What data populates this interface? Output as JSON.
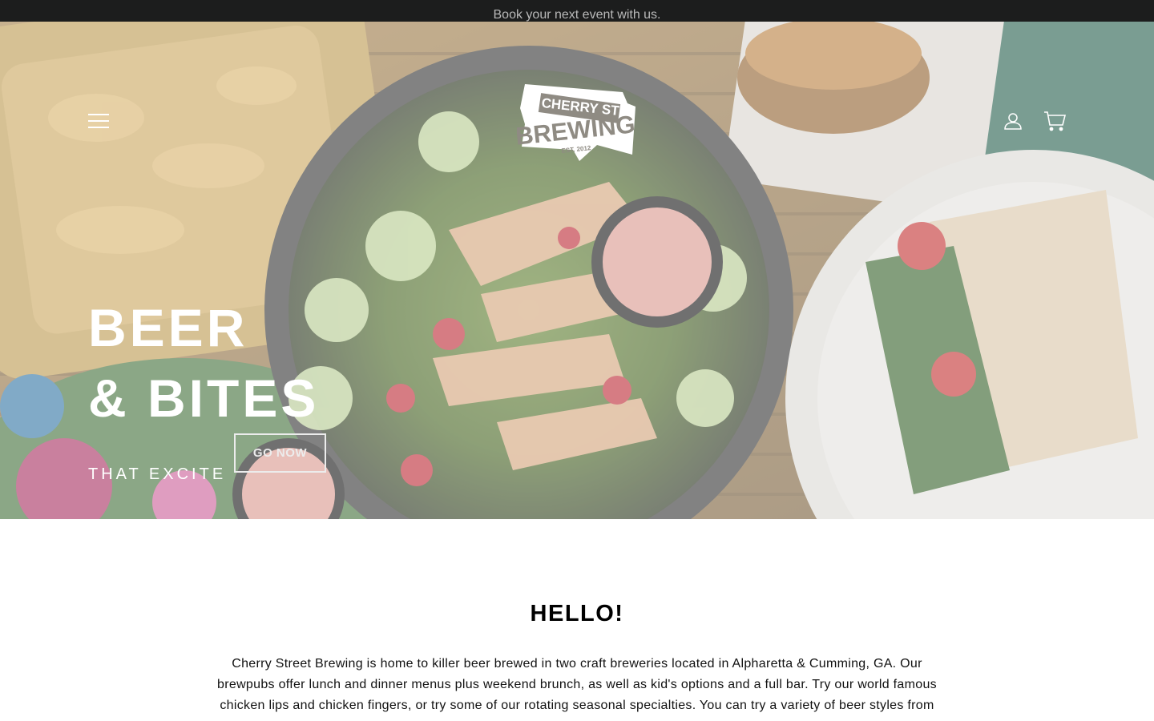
{
  "announcement": {
    "text": "Book your next event with us."
  },
  "header": {
    "menu_icon": "hamburger-menu-icon",
    "logo": {
      "line1": "CHERRY ST",
      "line2": "BREWING",
      "est": "EST. 2012"
    },
    "account_icon": "user-account-icon",
    "cart_icon": "shopping-cart-icon"
  },
  "hero": {
    "title_line1": "BEER",
    "title_line2": "& BITES",
    "subtitle": "THAT EXCITE",
    "button_label": "GO NOW"
  },
  "intro": {
    "heading": "HELLO!",
    "body": "Cherry Street Brewing is home to killer beer brewed in two craft breweries located in Alpharetta & Cumming, GA. Our brewpubs offer lunch and dinner menus plus weekend brunch, as well as kid's options and a full bar. Try our world famous chicken lips and chicken fingers, or try some of our rotating seasonal specialties. You can try a variety of beer styles from"
  },
  "colors": {
    "announcement_bg": "#1c1d1d",
    "announcement_text": "#b9b9b9",
    "hero_text": "#ffffff",
    "body_text": "#000000"
  }
}
